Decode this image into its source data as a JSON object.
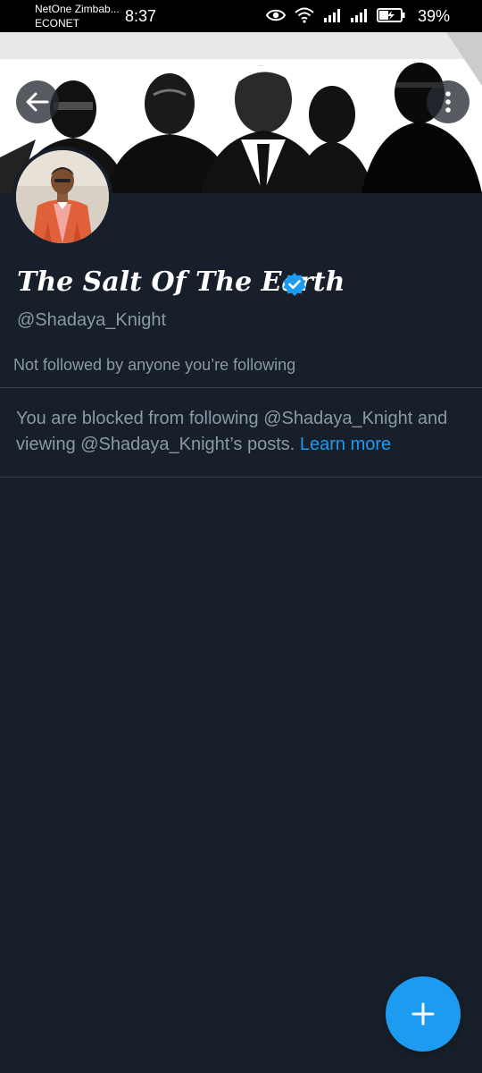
{
  "status_bar": {
    "carrier_primary": "NetOne Zimbab...",
    "carrier_secondary": "ECONET",
    "time": "8:37",
    "battery_percent": "39%"
  },
  "profile": {
    "display_name": "The Salt Of The Earth",
    "handle": "@Shadaya_Knight",
    "verified": true,
    "followed_by_note": "Not followed by anyone you’re following"
  },
  "blocked_notice": {
    "text": "You are blocked from following @Shadaya_Knight and viewing @Shadaya_Knight’s posts.",
    "link_label": "Learn more"
  },
  "colors": {
    "background": "#17202a",
    "accent": "#1d9bf0",
    "secondary_text": "#8b98a5",
    "divider": "#38444d"
  },
  "icons": {
    "back": "arrow-left-icon",
    "more": "more-vertical-icon",
    "verified": "verified-badge-icon",
    "compose": "plus-icon"
  }
}
